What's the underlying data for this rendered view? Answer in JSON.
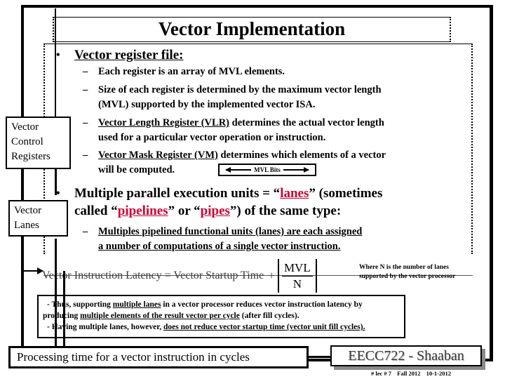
{
  "slide": {
    "title": "Vector Implementation"
  },
  "bullets": {
    "b1": {
      "marker": "•",
      "text": "Vector register file:",
      "subs": [
        {
          "marker": "–",
          "lines": [
            "Each register is an array of MVL elements."
          ]
        },
        {
          "marker": "–",
          "lines": [
            "Size of each register is determined by the maximum vector length",
            "(MVL) supported by the implemented vector ISA."
          ]
        },
        {
          "marker": "–",
          "underlined": "Vector Length Register (VLR)",
          "lines": [
            "determines the actual vector length",
            "used for a particular vector operation or instruction."
          ]
        },
        {
          "marker": "–",
          "underlined": "Vector Mask Register (VM)",
          "lines": [
            "determines which elements of a vector",
            "will be computed."
          ]
        }
      ]
    },
    "b2": {
      "marker": "•",
      "line1_a": "Multiple parallel execution units = “",
      "line1_red": "lanes",
      "line1_b": "” (sometimes",
      "line2_a": "called “",
      "line2_red1": "pipelines",
      "line2_b": "” or “",
      "line2_red2": "pipes",
      "line2_c": "”) of the same type:",
      "subs": [
        {
          "marker": "–",
          "lines": [
            "Multiples pipelined functional units (lanes) are each assigned",
            "a number of computations of a single vector instruction."
          ]
        }
      ]
    }
  },
  "mvl_bits": {
    "label": "MVL Bits",
    "arrow_left": "left-arrow",
    "arrow_right": "right-arrow"
  },
  "side_labels": {
    "vector_control_registers": "Vector\nControl\nRegisters",
    "vector_control_registers_lines": [
      "Vector",
      "Control",
      "Registers"
    ],
    "vector_lanes_lines": [
      "Vector",
      "Lanes"
    ]
  },
  "formula": {
    "text": "Vector Instruction Latency = Vector Startup Time",
    "plus": "+",
    "numerator": "MVL",
    "denominator": "N",
    "where_note_line1": "Where N is the number of lanes",
    "where_note_line2": "supported by the vector processor"
  },
  "notes": {
    "line1_a": "- Thus, supporting ",
    "line1_u": "multiple lanes",
    "line1_b": " in a vector processor reduces vector instruction latency by",
    "line2_a": "producing ",
    "line2_u": "multiple elements of the result vector per cycle",
    "line2_b": " (after fill cycles).",
    "line3_a": "- Having multiple lanes, however, ",
    "line3_u": "does not reduce  vector startup  time (vector unit fill cycles)."
  },
  "footer": {
    "processing_time_label": "Processing time for a vector instruction in cycles",
    "course_label": "EECC722 - Shaaban",
    "meta_lecture": "#  lec # 7",
    "meta_term": "Fall 2012",
    "meta_date": "10-1-2012"
  },
  "colors": {
    "accent_red": "#CC0033",
    "ink": "#000000"
  }
}
